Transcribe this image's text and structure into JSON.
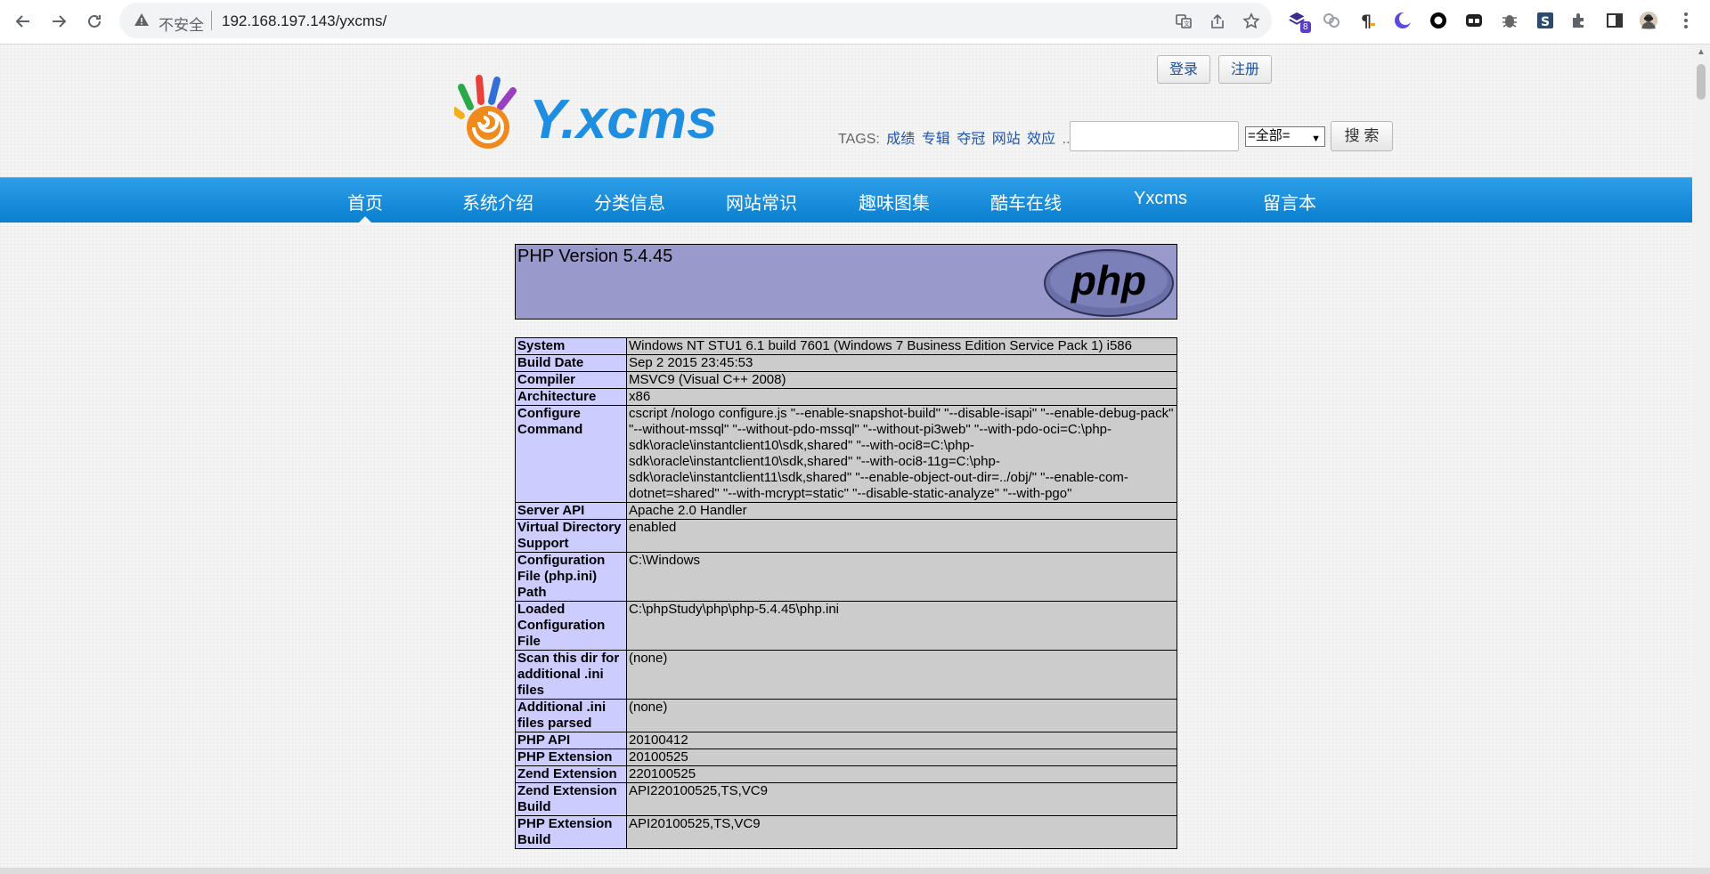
{
  "browser": {
    "insecure_label": "不安全",
    "url": "192.168.197.143/yxcms/",
    "extension_badge": "8"
  },
  "header": {
    "login_label": "登录",
    "register_label": "注册",
    "logo_text": "Y.xcms",
    "tags_label": "TAGS:",
    "tags": [
      "成绩",
      "专辑",
      "夺冠",
      "网站",
      "效应",
      "..."
    ],
    "search_input_value": "",
    "search_select_value": "=全部=",
    "search_button_label": "搜 索"
  },
  "nav": {
    "items": [
      "首页",
      "系统介绍",
      "分类信息",
      "网站常识",
      "趣味图集",
      "酷车在线",
      "Yxcms",
      "留言本"
    ],
    "active": "首页"
  },
  "phpinfo": {
    "version": "PHP Version 5.4.45",
    "logo_text": "php",
    "rows": [
      {
        "key": "System",
        "value": "Windows NT STU1 6.1 build 7601 (Windows 7 Business Edition Service Pack 1) i586"
      },
      {
        "key": "Build Date",
        "value": "Sep 2 2015 23:45:53"
      },
      {
        "key": "Compiler",
        "value": "MSVC9 (Visual C++ 2008)"
      },
      {
        "key": "Architecture",
        "value": "x86"
      },
      {
        "key": "Configure Command",
        "value": "cscript /nologo configure.js \"--enable-snapshot-build\" \"--disable-isapi\" \"--enable-debug-pack\" \"--without-mssql\" \"--without-pdo-mssql\" \"--without-pi3web\" \"--with-pdo-oci=C:\\php-sdk\\oracle\\instantclient10\\sdk,shared\" \"--with-oci8=C:\\php-sdk\\oracle\\instantclient10\\sdk,shared\" \"--with-oci8-11g=C:\\php-sdk\\oracle\\instantclient11\\sdk,shared\" \"--enable-object-out-dir=../obj/\" \"--enable-com-dotnet=shared\" \"--with-mcrypt=static\" \"--disable-static-analyze\" \"--with-pgo\""
      },
      {
        "key": "Server API",
        "value": "Apache 2.0 Handler"
      },
      {
        "key": "Virtual Directory Support",
        "value": "enabled"
      },
      {
        "key": "Configuration File (php.ini) Path",
        "value": "C:\\Windows"
      },
      {
        "key": "Loaded Configuration File",
        "value": "C:\\phpStudy\\php\\php-5.4.45\\php.ini"
      },
      {
        "key": "Scan this dir for additional .ini files",
        "value": "(none)"
      },
      {
        "key": "Additional .ini files parsed",
        "value": "(none)"
      },
      {
        "key": "PHP API",
        "value": "20100412"
      },
      {
        "key": "PHP Extension",
        "value": "20100525"
      },
      {
        "key": "Zend Extension",
        "value": "220100525"
      },
      {
        "key": "Zend Extension Build",
        "value": "API220100525,TS,VC9"
      },
      {
        "key": "PHP Extension Build",
        "value": "API20100525,TS,VC9"
      }
    ]
  }
}
